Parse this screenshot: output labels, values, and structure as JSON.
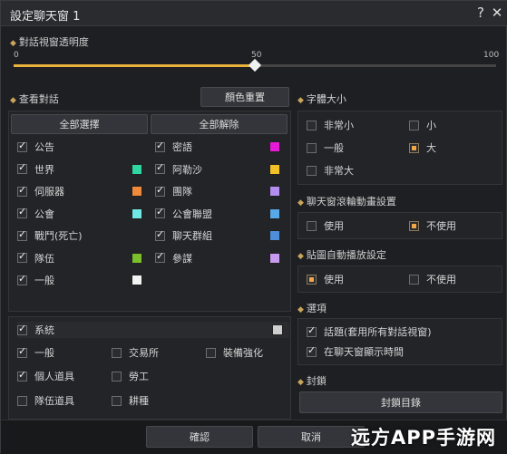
{
  "window": {
    "title": "設定聊天窗 1",
    "help": "?",
    "close": "✕"
  },
  "opacity": {
    "label": "對話視窗透明度",
    "min": "0",
    "mid": "50",
    "max": "100",
    "value": 50
  },
  "chat": {
    "label": "查看對話",
    "reset": "顏色重置",
    "select_all": "全部選擇",
    "deselect_all": "全部解除",
    "left": [
      {
        "label": "公告",
        "on": true,
        "color": ""
      },
      {
        "label": "世界",
        "on": true,
        "color": "#2fd7a0"
      },
      {
        "label": "伺服器",
        "on": true,
        "color": "#f08a3a"
      },
      {
        "label": "公會",
        "on": true,
        "color": "#6fe8e6"
      },
      {
        "label": "戰鬥(死亡)",
        "on": true,
        "color": ""
      },
      {
        "label": "隊伍",
        "on": true,
        "color": "#7bbf2a"
      },
      {
        "label": "一般",
        "on": true,
        "color": "#f2f2f2"
      }
    ],
    "right": [
      {
        "label": "密語",
        "on": true,
        "color": "#e81ad8"
      },
      {
        "label": "阿勒沙",
        "on": true,
        "color": "#f2c128"
      },
      {
        "label": "團隊",
        "on": true,
        "color": "#b38ef0"
      },
      {
        "label": "公會聯盟",
        "on": true,
        "color": "#58a9e8"
      },
      {
        "label": "聊天群組",
        "on": true,
        "color": "#4f8fda"
      },
      {
        "label": "參謀",
        "on": true,
        "color": "#c79af0"
      }
    ]
  },
  "system": {
    "label": "系統",
    "on": true,
    "items": [
      {
        "label": "一般",
        "on": true
      },
      {
        "label": "交易所",
        "on": false
      },
      {
        "label": "裝備強化",
        "on": false
      },
      {
        "label": "個人道具",
        "on": true
      },
      {
        "label": "勞工",
        "on": false
      },
      {
        "label": "隊伍道具",
        "on": false
      },
      {
        "label": "耕種",
        "on": false
      }
    ]
  },
  "font": {
    "label": "字體大小",
    "options": [
      "非常小",
      "小",
      "一般",
      "大",
      "非常大"
    ],
    "selected": "大"
  },
  "scroll": {
    "label": "聊天窗滾輪動畫設置",
    "options": [
      "使用",
      "不使用"
    ],
    "selected": "不使用"
  },
  "sticker": {
    "label": "貼圖自動播放設定",
    "options": [
      "使用",
      "不使用"
    ],
    "selected": "使用"
  },
  "options": {
    "label": "選項",
    "items": [
      {
        "label": "話題(套用所有對話視窗)",
        "on": true
      },
      {
        "label": "在聊天窗顯示時間",
        "on": true
      }
    ]
  },
  "lock": {
    "label": "封鎖",
    "button": "封鎖目錄"
  },
  "footer": {
    "confirm": "確認",
    "cancel": "取消"
  },
  "watermark": "远方APP手游网"
}
